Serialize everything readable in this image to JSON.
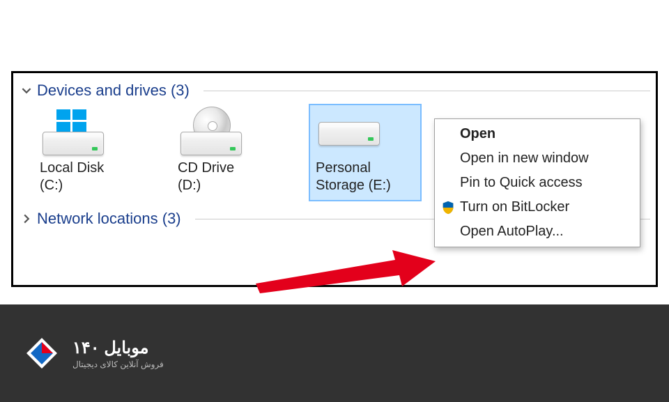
{
  "section_devices": {
    "title": "Devices and drives (3)"
  },
  "section_network": {
    "title": "Network locations (3)"
  },
  "drives": [
    {
      "label_line1": "Local Disk",
      "label_line2": "(C:)"
    },
    {
      "label_line1": "CD Drive",
      "label_line2": "(D:)"
    },
    {
      "label_line1": "Personal",
      "label_line2": "Storage (E:)"
    }
  ],
  "context_menu": {
    "open": "Open",
    "new_window": "Open in new window",
    "pin_quick": "Pin to Quick access",
    "bitlocker": "Turn on BitLocker",
    "autoplay": "Open AutoPlay..."
  },
  "footer": {
    "brand": "موبایل ۱۴۰",
    "tagline": "فروش آنلاین کالای دیجیتال"
  }
}
